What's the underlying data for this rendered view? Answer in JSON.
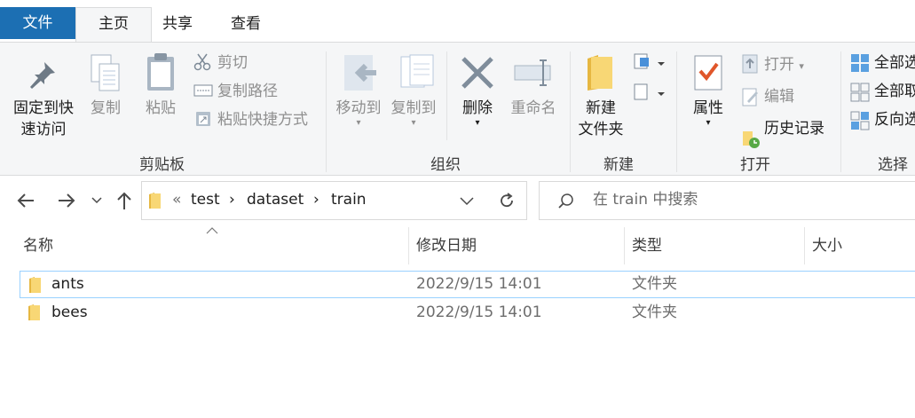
{
  "tabs": {
    "file": "文件",
    "home": "主页",
    "share": "共享",
    "view": "查看"
  },
  "ribbon": {
    "pin": [
      "固定到快",
      "速访问"
    ],
    "copy": "复制",
    "paste": "粘贴",
    "cut": "剪切",
    "copy_path": "复制路径",
    "paste_shortcut": "粘贴快捷方式",
    "group_clipboard": "剪贴板",
    "move_to": "移动到",
    "copy_to": "复制到",
    "delete": "删除",
    "rename": "重命名",
    "group_organize": "组织",
    "new_folder": [
      "新建",
      "文件夹"
    ],
    "group_new": "新建",
    "properties": "属性",
    "open": "打开",
    "edit": "编辑",
    "history": "历史记录",
    "group_open": "打开",
    "select_all": "全部选",
    "select_none": "全部取",
    "invert": "反向选",
    "group_select": "选择"
  },
  "breadcrumb": {
    "overflow": "«",
    "items": [
      "test",
      "dataset",
      "train"
    ]
  },
  "search": {
    "placeholder": "在 train 中搜索"
  },
  "columns": {
    "name": "名称",
    "modified": "修改日期",
    "type": "类型",
    "size": "大小"
  },
  "rows": [
    {
      "name": "ants",
      "modified": "2022/9/15 14:01",
      "type": "文件夹"
    },
    {
      "name": "bees",
      "modified": "2022/9/15 14:01",
      "type": "文件夹"
    }
  ],
  "colors": {
    "file_tab": "#1c6fb3",
    "folder": "#f8d775",
    "selection_border": "#99d1ff"
  }
}
